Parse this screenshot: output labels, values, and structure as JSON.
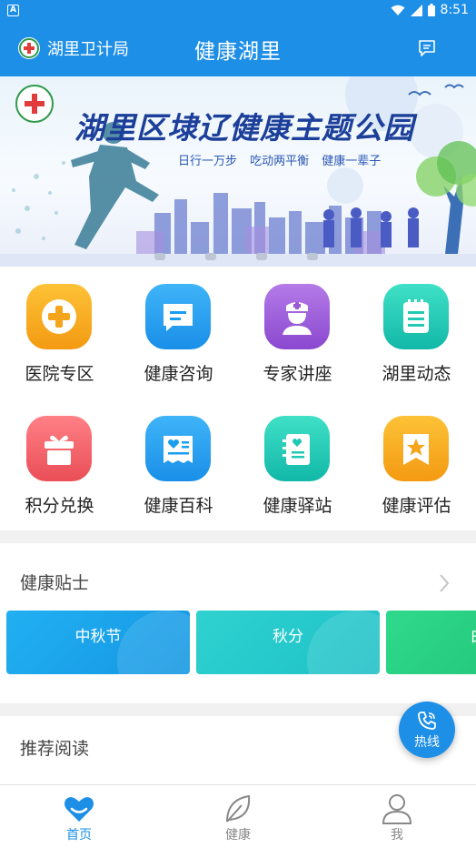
{
  "status_bar": {
    "time": "8:51"
  },
  "header": {
    "dept_name": "湖里卫计局",
    "title": "健康湖里"
  },
  "banner": {
    "title": "湖里区埭辽健康主题公园",
    "subtitle": "日行一万步 吃动两平衡 健康一辈子"
  },
  "grid_items": [
    {
      "label": "医院专区",
      "icon": "plus-icon",
      "color": "#f5a51c"
    },
    {
      "label": "健康咨询",
      "icon": "chat-icon",
      "color": "#1a9ef0"
    },
    {
      "label": "专家讲座",
      "icon": "doctor-icon",
      "color": "#9b59d6"
    },
    {
      "label": "湖里动态",
      "icon": "notepad-icon",
      "color": "#21c9b3"
    },
    {
      "label": "积分兑换",
      "icon": "gift-icon",
      "color": "#f06266"
    },
    {
      "label": "健康百科",
      "icon": "heart-doc-icon",
      "color": "#1a9ef0"
    },
    {
      "label": "健康驿站",
      "icon": "heart-book-icon",
      "color": "#21c9b3"
    },
    {
      "label": "健康评估",
      "icon": "star-bookmark-icon",
      "color": "#f5a51c"
    }
  ],
  "health_tips": {
    "title": "健康贴士",
    "cards": [
      {
        "label": "中秋节",
        "color": "#1aa5ec"
      },
      {
        "label": "秋分",
        "color": "#26c6cf"
      },
      {
        "label": "白",
        "color": "#26c780"
      }
    ]
  },
  "recommended": {
    "title": "推荐阅读"
  },
  "hotline": {
    "label": "热线"
  },
  "tabs": [
    {
      "label": "首页",
      "active": true
    },
    {
      "label": "健康",
      "active": false
    },
    {
      "label": "我",
      "active": false
    }
  ],
  "colors": {
    "primary": "#1e8fe6",
    "tab_inactive": "#888888"
  }
}
